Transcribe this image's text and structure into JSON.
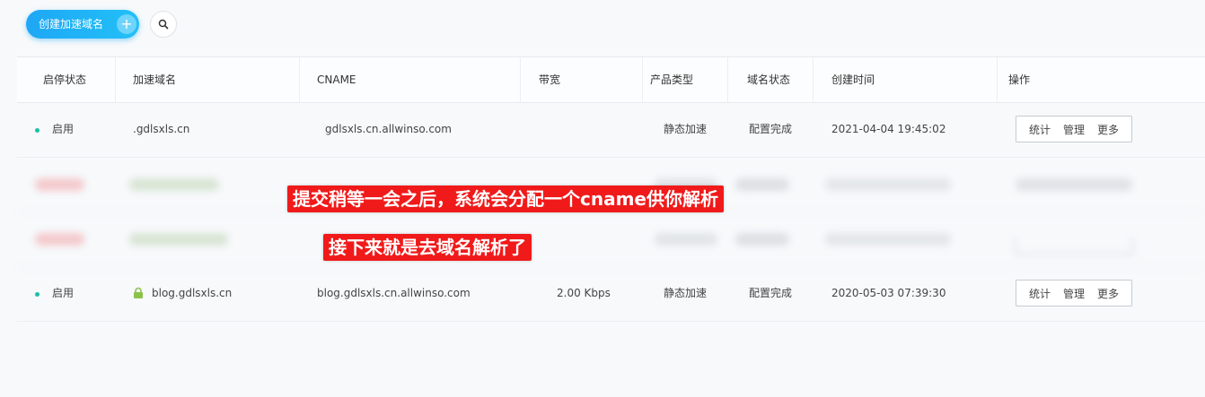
{
  "toolbar": {
    "create_label": "创建加速域名",
    "plus_symbol": "+"
  },
  "columns": [
    "启停状态",
    "加速域名",
    "CNAME",
    "带宽",
    "产品类型",
    "域名状态",
    "创建时间",
    "操作"
  ],
  "rows": [
    {
      "status": "启用",
      "domain": ".gdlsxls.cn",
      "cname": "gdlsxls.cn.allwinso.com",
      "bandwidth": "",
      "product": "静态加速",
      "domain_status": "配置完成",
      "created": "2021-04-04 19:45:02",
      "has_lock": false
    },
    {
      "status": "启用",
      "domain": "blog.gdlsxls.cn",
      "cname": "blog.gdlsxls.cn.allwinso.com",
      "bandwidth": "2.00 Kbps",
      "product": "静态加速",
      "domain_status": "配置完成",
      "created": "2020-05-03 07:39:30",
      "has_lock": true
    }
  ],
  "ops": {
    "stats": "统计",
    "manage": "管理",
    "more": "更多"
  },
  "annotations": {
    "callout1": "提交稍等一会之后，系统会分配一个cname供你解析",
    "callout2": "接下来就是去域名解析了"
  },
  "colors": {
    "accent": "#1ea7f5",
    "status_dot": "#19c1a6",
    "callout_bg": "#f01a1a"
  },
  "icons": {
    "search": "search-icon",
    "lock": "lock-icon",
    "plus": "plus-icon"
  }
}
